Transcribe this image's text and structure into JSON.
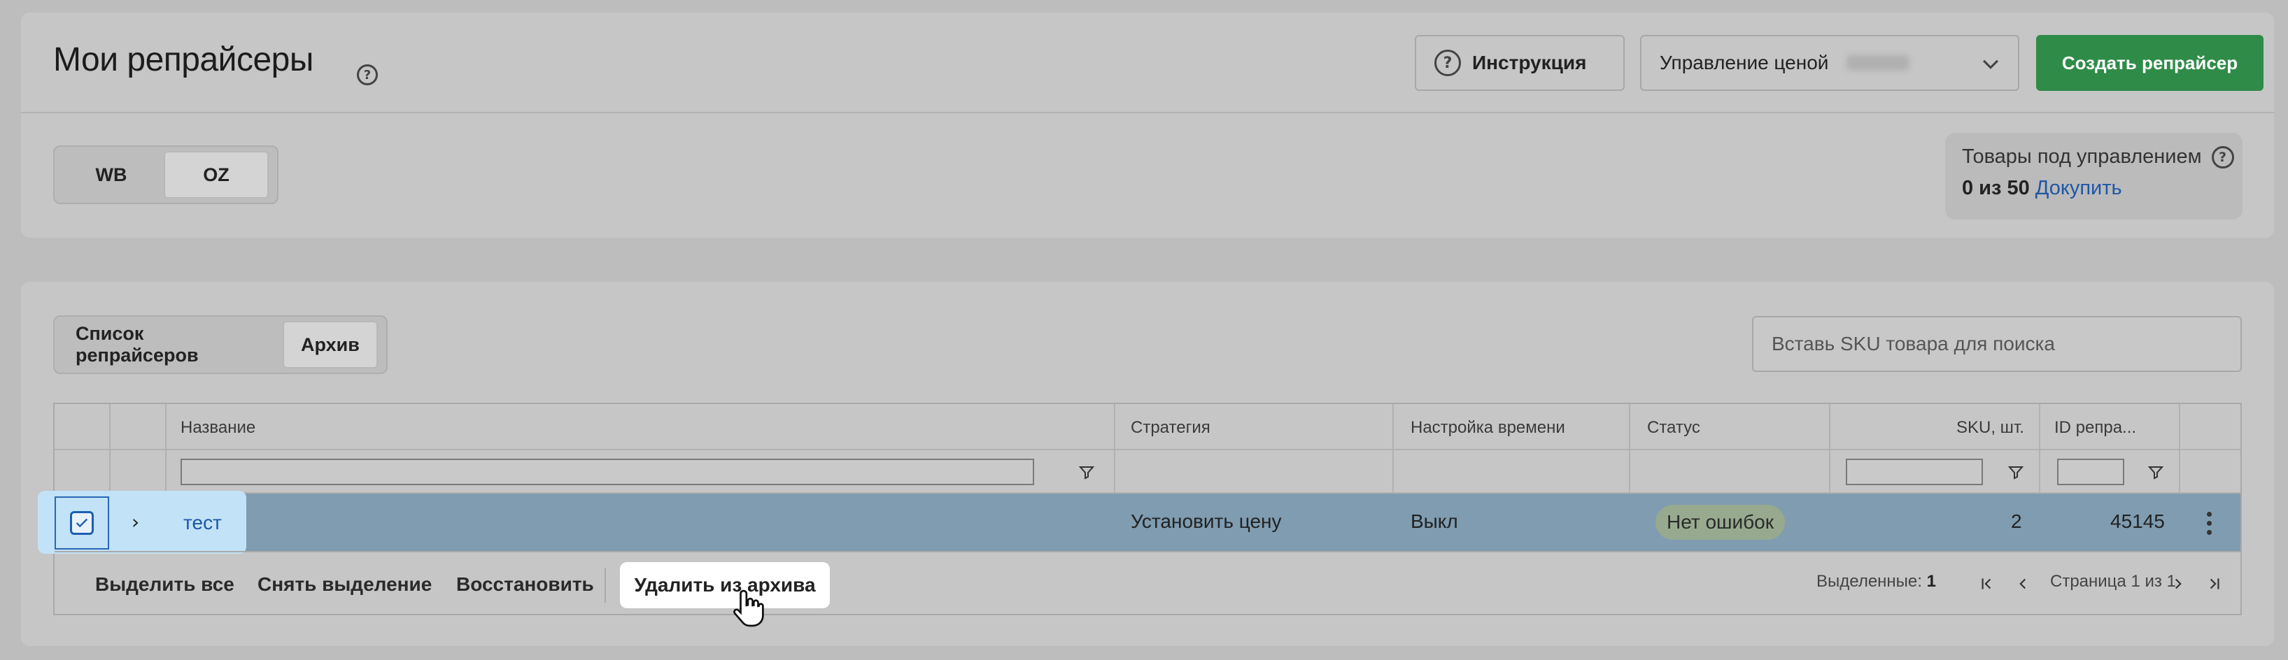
{
  "header": {
    "title": "Мои репрайсеры",
    "instruction_label": "Инструкция",
    "price_control_label": "Управление ценой",
    "create_label": "Создать репрайсер"
  },
  "marketplace_tabs": [
    "WB",
    "OZ"
  ],
  "marketplace_active": "OZ",
  "goods_box": {
    "title": "Товары под управлением",
    "count": "0 из 50",
    "buy_link": "Докупить"
  },
  "list_tabs": [
    "Список репрайсеров",
    "Архив"
  ],
  "list_active": "Архив",
  "search": {
    "placeholder": "Вставь SKU товара для поиска"
  },
  "table": {
    "columns": [
      "Название",
      "Стратегия",
      "Настройка времени",
      "Статус",
      "SKU, шт.",
      "ID репра..."
    ],
    "rows": [
      {
        "name": "тест",
        "strategy": "Установить цену",
        "time_setting": "Выкл",
        "status": "Нет ошибок",
        "sku": "2",
        "id": "45145",
        "selected": true
      }
    ]
  },
  "actions": {
    "select_all": "Выделить все",
    "deselect": "Снять выделение",
    "restore": "Восстановить",
    "delete_from_archive": "Удалить из архива"
  },
  "pager": {
    "selected_label": "Выделенные:",
    "selected_count": "1",
    "page_text": "Страница 1 из 1"
  },
  "colors": {
    "accent_green": "#2f8b48",
    "link_blue": "#1e57a5",
    "selected_row": "#7f9cb1"
  }
}
